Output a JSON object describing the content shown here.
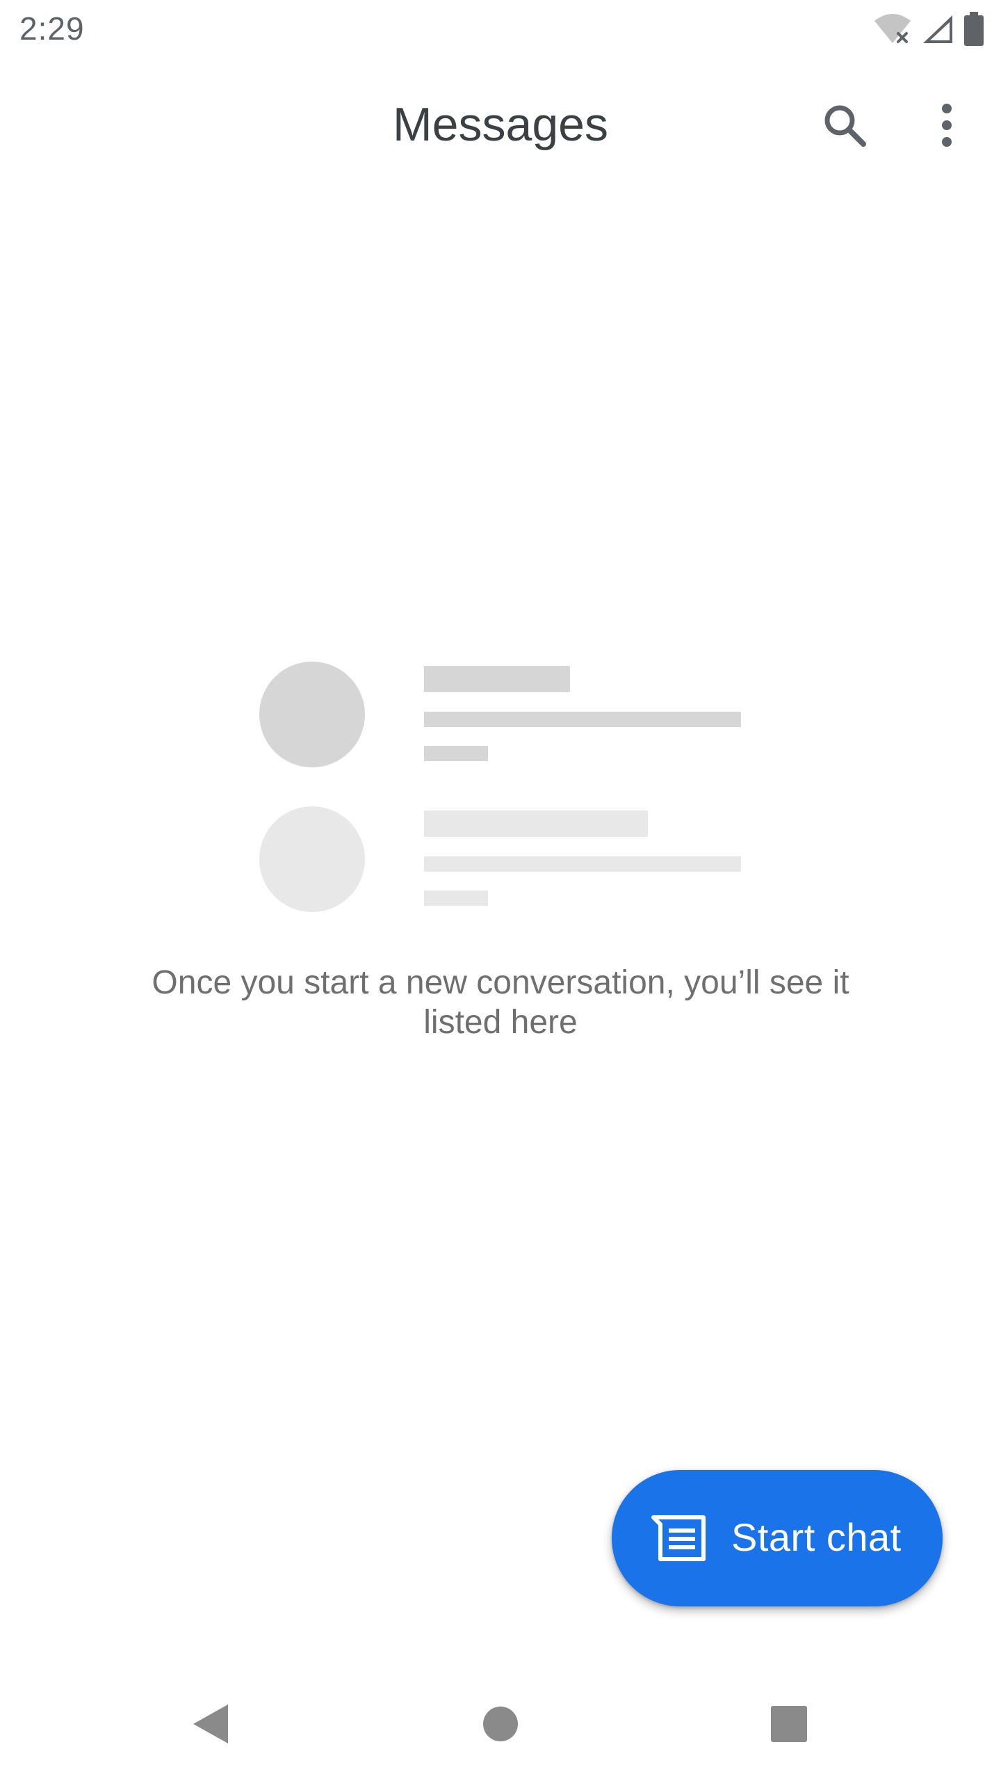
{
  "status_bar": {
    "time": "2:29",
    "icons": [
      "wifi-off-icon",
      "cell-signal-icon",
      "battery-icon"
    ]
  },
  "app_bar": {
    "title": "Messages",
    "actions": [
      "search-icon",
      "more-vert-icon"
    ]
  },
  "empty_state": {
    "message": "Once you start a new conversation, you’ll see it listed here"
  },
  "fab": {
    "label": "Start chat",
    "icon": "chat-icon",
    "color": "#1a73e8"
  },
  "nav_bar": {
    "buttons": [
      "back-icon",
      "home-icon",
      "recents-icon"
    ]
  },
  "colors": {
    "icon_gray": "#5f6368",
    "title_text": "#3c4043",
    "body_text": "#6f6f6f",
    "skeleton_dark": "#d6d6d6",
    "skeleton_light": "#e8e8e8",
    "nav_gray": "#8a8a8a"
  }
}
